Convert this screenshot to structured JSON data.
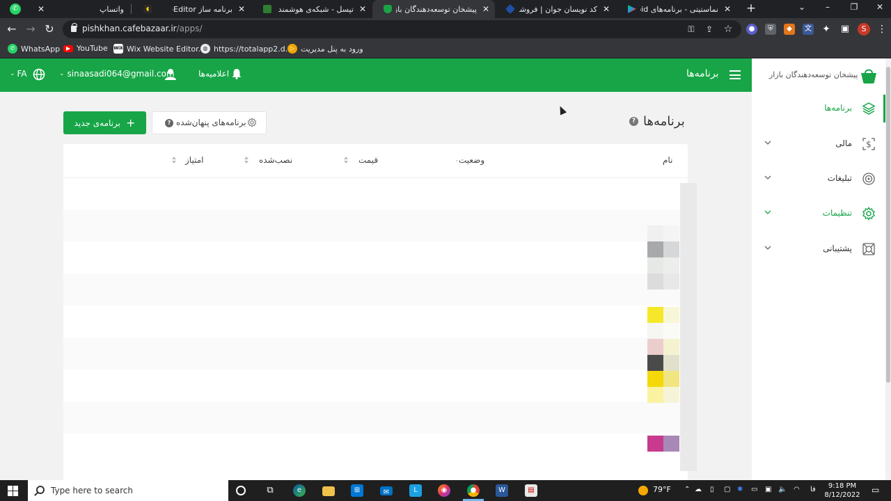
{
  "browser": {
    "tabs": [
      {
        "title": "واتساپ",
        "active": false
      },
      {
        "title": "برنامه ساز AppEditor",
        "active": false
      },
      {
        "title": "تپسل - شبکه‌ی هوشمند و هد",
        "active": false
      },
      {
        "title": "پیشخان توسعه‌دهندگان بازار",
        "active": true
      },
      {
        "title": "کد نویسان جوان | فروشگاه س",
        "active": false
      },
      {
        "title": "نماستیتی - برنامه‌های Android",
        "active": false
      }
    ],
    "url_host": "pishkhan.cafebazaar.ir",
    "url_path": "/apps/",
    "profile_initial": "S"
  },
  "bookmarks": [
    {
      "label": "WhatsApp",
      "icon": "whatsapp-icon"
    },
    {
      "label": "YouTube",
      "icon": "youtube-icon"
    },
    {
      "label": "Wix Website Editor...",
      "icon": "wix-icon"
    },
    {
      "label": "https://totalapp2.d...",
      "icon": "globe-icon"
    },
    {
      "label": "ورود به پنل مدیریت",
      "icon": "panel-icon"
    }
  ],
  "header": {
    "title": "برنامه‌ها",
    "notifications_label": "اعلامیه‌ها",
    "email": "sinaasadi064@gmail.com",
    "language": "FA"
  },
  "sidebar": {
    "brand": "پیشخان توسعه‌دهندگان بازار",
    "items": [
      {
        "label": "برنامه‌ها",
        "icon": "layers-icon",
        "active": true,
        "expandable": false
      },
      {
        "label": "مالی",
        "icon": "dollar-icon",
        "active": false,
        "expandable": true
      },
      {
        "label": "تبلیغات",
        "icon": "target-icon",
        "active": false,
        "expandable": true
      },
      {
        "label": "تنظیمات",
        "icon": "gear-icon",
        "active": false,
        "expandable": true
      },
      {
        "label": "پشتیبانی",
        "icon": "lifebuoy-icon",
        "active": false,
        "expandable": true
      }
    ]
  },
  "main": {
    "page_title": "برنامه‌ها",
    "new_app_button": "برنامه‌ی جدید",
    "hidden_apps_button": "برنامه‌های پنهان‌شده",
    "table": {
      "columns": [
        "نام",
        "وضعیت",
        "قیمت",
        "نصب‌شده",
        "امتیاز"
      ]
    }
  },
  "taskbar": {
    "search_placeholder": "Type here to search",
    "temperature": "79°F",
    "time": "9:18 PM",
    "date": "8/12/2022",
    "input_lang": "فا"
  },
  "colors": {
    "brand_green": "#17a547",
    "chrome_dark": "#202124",
    "chrome_mid": "#35363a"
  }
}
